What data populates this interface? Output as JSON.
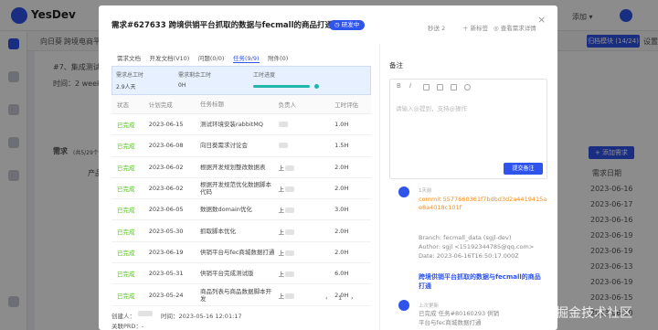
{
  "app": {
    "name": "YesDev"
  },
  "background": {
    "top_right": "添加 ▾",
    "header_items": [
      "向日葵",
      "跨境电商平台"
    ],
    "header_button": "归档模块 (14/24)",
    "header_settings": "设置",
    "row_texts": [
      "#7、集成测试",
      "时间：2 week"
    ],
    "section_title": "需求",
    "section_count": "(共5/29个)",
    "add_button": "+ 添加需求",
    "col_product": "产品",
    "col_date": "需求日期",
    "bg_dates": [
      "2023-06-16",
      "2023-06-17",
      "2023-06-16",
      "2023-06-19",
      "2023-06-19",
      "2023-06-13",
      "2023-06-19",
      "2023-06-15",
      "2023-06-20"
    ]
  },
  "modal": {
    "title": "需求#627633 跨境供销平台抓取的数据与fecmall的商品打通",
    "status_badge": "研发中",
    "meta_views": "秒送 2",
    "meta_new": "新标签",
    "meta_detail": "查看需求详情",
    "close": "×",
    "tabs": [
      {
        "label": "需求文档",
        "active": false
      },
      {
        "label": "开发文档(V10)",
        "active": false
      },
      {
        "label": "问题(0/0)",
        "active": false
      },
      {
        "label": "任务(9/9)",
        "active": true
      },
      {
        "label": "附件(0)",
        "active": false
      }
    ],
    "stats": {
      "total_label": "需求总工时",
      "total_value": "2.9人天",
      "remain_label": "需求剩余工时",
      "remain_value": "0H",
      "progress_label": "工时进度",
      "progress_value": 1.0
    },
    "table": {
      "headers": [
        "状态",
        "计划完成",
        "任务标题",
        "负责人",
        "工时评估"
      ],
      "rows": [
        {
          "status": "已完成",
          "date": "2023-06-15",
          "title": "测试环境安装rabbitMQ",
          "owner": "",
          "hours": "1.0H"
        },
        {
          "status": "已完成",
          "date": "2023-06-08",
          "title": "向日葵需求讨论会",
          "owner": "",
          "hours": "1.5H"
        },
        {
          "status": "已完成",
          "date": "2023-06-02",
          "title": "根据开发规划整改数据表",
          "owner": "上",
          "hours": "2.0H"
        },
        {
          "status": "已完成",
          "date": "2023-06-02",
          "title": "根据开发规范优化数据脚本代码",
          "owner": "上",
          "hours": "2.0H"
        },
        {
          "status": "已完成",
          "date": "2023-06-05",
          "title": "数据数domain优化",
          "owner": "上",
          "hours": "3.0H"
        },
        {
          "status": "已完成",
          "date": "2023-05-30",
          "title": "抓取脚本优化",
          "owner": "上",
          "hours": "2.0H"
        },
        {
          "status": "已完成",
          "date": "2023-06-19",
          "title": "供销平台与fec商城数据打通",
          "owner": "上",
          "hours": "2.0H"
        },
        {
          "status": "已完成",
          "date": "2023-05-31",
          "title": "供销平台完成测试版",
          "owner": "上",
          "hours": "6.0H"
        },
        {
          "status": "已完成",
          "date": "2023-05-24",
          "title": "商品列表与商品数据脚本开发",
          "owner": "上",
          "hours": "2.0H"
        }
      ]
    },
    "pager": {
      "prev": "‹",
      "page": "1",
      "next": "›"
    },
    "footer": {
      "creator": "创建人：",
      "time": "时间：2023-05-16 12:01:17",
      "prd": "关联PRD：-"
    },
    "notes": {
      "title": "备注",
      "toolbar": [
        "B",
        "I",
        "img",
        "quote",
        "image",
        "link"
      ],
      "placeholder": "请输入@提到，支持@操作",
      "submit": "提交备注"
    },
    "activity": [
      {
        "time": "1天前",
        "commit": "commit 5577660361f7bdbd3d2a4419415ae8a4018c101f",
        "branch": "Branch: fecmall_data (sgjl-dev)",
        "author": "Author: sgjl <15192344785@qq.com>",
        "date": "Date: 2023-06-16T16:50:17.000Z",
        "link": "跨境供销平台抓取的数据与fecmall的商品打通"
      },
      {
        "time": "上次更新",
        "text1": "已完成 任务#80160293 供销",
        "text2": "平台与fec商城数据打通"
      }
    ]
  },
  "watermark": "@稀土掘金技术社区"
}
